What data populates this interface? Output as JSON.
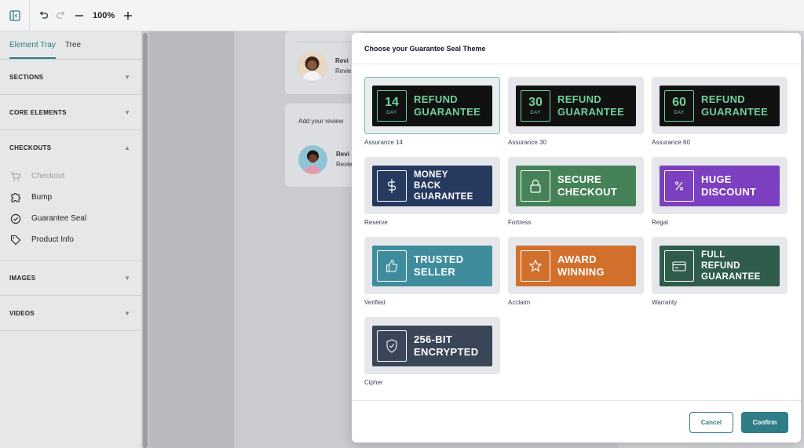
{
  "toolbar": {
    "zoom": "100%",
    "icons": [
      "panel-toggle-icon",
      "undo-icon",
      "redo-icon",
      "zoom-out-icon",
      "zoom-in-icon"
    ]
  },
  "sidebar": {
    "tabs": [
      "Element Tray",
      "Tree"
    ],
    "active_tab": "Element Tray",
    "sections": {
      "sections": "SECTIONS",
      "core": "CORE ELEMENTS",
      "checkouts": "CHECKOUTS",
      "images": "IMAGES",
      "videos": "VIDEOS"
    },
    "checkout_items": [
      {
        "label": "Checkout",
        "icon": "cart-icon",
        "disabled": true
      },
      {
        "label": "Bump",
        "icon": "puzzle-icon",
        "disabled": false
      },
      {
        "label": "Guarantee Seal",
        "icon": "badge-check-icon",
        "disabled": false
      },
      {
        "label": "Product Info",
        "icon": "tag-icon",
        "disabled": false
      }
    ]
  },
  "background": {
    "review_name_1": "Revi",
    "review_text_1": "Revie",
    "add_review": "Add your review",
    "review_name_2": "Revi",
    "review_text_2": "Revie"
  },
  "modal": {
    "title": "Choose your Guarantee Seal Theme",
    "seals": [
      {
        "name": "Assurance 14",
        "num": "14",
        "day": "DAY",
        "lines": [
          "REFUND",
          "GUARANTEE"
        ],
        "bg": "#111111",
        "fg": "#6fd19c",
        "selected": true
      },
      {
        "name": "Assurance 30",
        "num": "30",
        "day": "DAY",
        "lines": [
          "REFUND",
          "GUARANTEE"
        ],
        "bg": "#111111",
        "fg": "#6fd19c",
        "selected": false
      },
      {
        "name": "Assurance 60",
        "num": "60",
        "day": "DAY",
        "lines": [
          "REFUND",
          "GUARANTEE"
        ],
        "bg": "#111111",
        "fg": "#6fd19c",
        "selected": false
      },
      {
        "name": "Reserve",
        "icon": "dollar-icon",
        "lines": [
          "MONEY",
          "BACK",
          "GUARANTEE"
        ],
        "bg": "#263a60",
        "fg": "#ffffff",
        "selected": false
      },
      {
        "name": "Fortress",
        "icon": "lock-icon",
        "lines": [
          "SECURE",
          "CHECKOUT"
        ],
        "bg": "#468258",
        "fg": "#ffffff",
        "selected": false
      },
      {
        "name": "Regal",
        "icon": "percent-icon",
        "lines": [
          "HUGE",
          "DISCOUNT"
        ],
        "bg": "#7b3fbf",
        "fg": "#ffffff",
        "selected": false
      },
      {
        "name": "Verified",
        "icon": "thumbs-up-icon",
        "lines": [
          "TRUSTED",
          "SELLER"
        ],
        "bg": "#3f8d9c",
        "fg": "#ffffff",
        "selected": false
      },
      {
        "name": "Acclaim",
        "icon": "star-icon",
        "lines": [
          "AWARD",
          "WINNING"
        ],
        "bg": "#d26f2c",
        "fg": "#ffffff",
        "selected": false
      },
      {
        "name": "Warranty",
        "icon": "credit-card-icon",
        "lines": [
          "FULL",
          "REFUND",
          "GUARANTEE"
        ],
        "bg": "#2f5c4b",
        "fg": "#ffffff",
        "selected": false
      },
      {
        "name": "Cipher",
        "icon": "shield-check-icon",
        "lines": [
          "256-BIT",
          "ENCRYPTED"
        ],
        "bg": "#3a4557",
        "fg": "#ffffff",
        "selected": false
      }
    ],
    "cancel_label": "Cancel",
    "confirm_label": "Confirm"
  },
  "colors": {
    "accent": "#2f7d86"
  }
}
